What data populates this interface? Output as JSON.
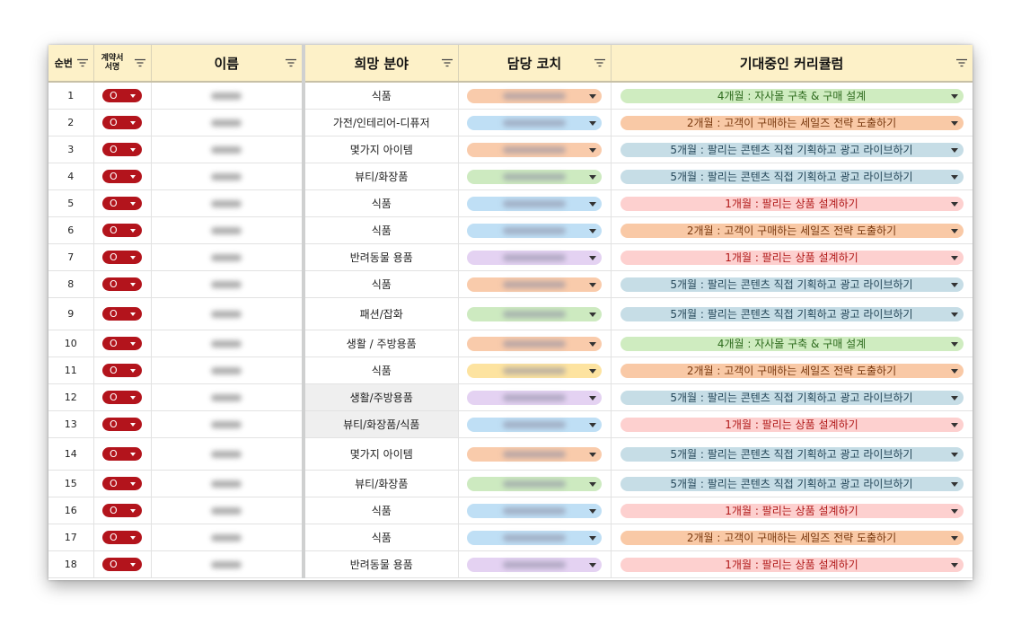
{
  "headers": {
    "seq": "순번",
    "contract": "계약서\n서명",
    "name": "이름",
    "field": "희망 분야",
    "coach": "담당 코치",
    "curriculum": "기대중인 커리큘럼"
  },
  "colors": {
    "header_bg": "#fdf1c8",
    "sign_chip": "#b3141c",
    "coach_orange": "#f9cbab",
    "coach_blue": "#bfdff5",
    "coach_green": "#cdeac0",
    "coach_purple": "#e4d2f2",
    "coach_yellow": "#fde3a0",
    "course_green": "#cfecc0",
    "course_orange": "#f9c9a6",
    "course_blue": "#c6dde6",
    "course_pink": "#fdd0cf"
  },
  "rows": [
    {
      "seq": "1",
      "sign": "O",
      "field": "식품",
      "coach": "orange",
      "curriculum": "4개월 : 자사몰 구축 & 구매 설계",
      "cc": "green"
    },
    {
      "seq": "2",
      "sign": "O",
      "field": "가전/인테리어-디퓨저",
      "coach": "blue",
      "curriculum": "2개월 : 고객이 구매하는 세일즈 전략 도출하기",
      "cc": "orange"
    },
    {
      "seq": "3",
      "sign": "O",
      "field": "몇가지 아이템",
      "coach": "orange",
      "curriculum": "5개월 : 팔리는 콘텐츠 직접 기획하고 광고 라이브하기",
      "cc": "blue"
    },
    {
      "seq": "4",
      "sign": "O",
      "field": "뷰티/화장품",
      "coach": "green",
      "curriculum": "5개월 : 팔리는 콘텐츠 직접 기획하고 광고 라이브하기",
      "cc": "blue"
    },
    {
      "seq": "5",
      "sign": "O",
      "field": "식품",
      "coach": "blue",
      "curriculum": "1개월 : 팔리는 상품 설계하기",
      "cc": "pink"
    },
    {
      "seq": "6",
      "sign": "O",
      "field": "식품",
      "coach": "blue",
      "curriculum": "2개월 : 고객이 구매하는 세일즈 전략 도출하기",
      "cc": "orange"
    },
    {
      "seq": "7",
      "sign": "O",
      "field": "반려동물 용품",
      "coach": "purple",
      "curriculum": "1개월 : 팔리는 상품 설계하기",
      "cc": "pink"
    },
    {
      "seq": "8",
      "sign": "O",
      "field": "식품",
      "coach": "orange",
      "curriculum": "5개월 : 팔리는 콘텐츠 직접 기획하고 광고 라이브하기",
      "cc": "blue"
    },
    {
      "seq": "9",
      "sign": "O",
      "field": "패션/잡화",
      "coach": "green",
      "curriculum": "5개월 : 팔리는 콘텐츠 직접 기획하고 광고 라이브하기",
      "cc": "blue",
      "tall": true
    },
    {
      "seq": "10",
      "sign": "O",
      "field": "생활 / 주방용품",
      "coach": "orange",
      "curriculum": "4개월 : 자사몰 구축 & 구매 설계",
      "cc": "green"
    },
    {
      "seq": "11",
      "sign": "O",
      "field": "식품",
      "coach": "yellow",
      "curriculum": "2개월 : 고객이 구매하는 세일즈 전략 도출하기",
      "cc": "orange"
    },
    {
      "seq": "12",
      "sign": "O",
      "field": "생활/주방용품",
      "coach": "purple",
      "curriculum": "5개월 : 팔리는 콘텐츠 직접 기획하고 광고 라이브하기",
      "cc": "blue",
      "shade": true
    },
    {
      "seq": "13",
      "sign": "O",
      "field": "뷰티/화장품/식품",
      "coach": "blue",
      "curriculum": "1개월 : 팔리는 상품 설계하기",
      "cc": "pink",
      "shade": true
    },
    {
      "seq": "14",
      "sign": "O",
      "field": "몇가지 아이템",
      "coach": "orange",
      "curriculum": "5개월 : 팔리는 콘텐츠 직접 기획하고 광고 라이브하기",
      "cc": "blue",
      "tall": true
    },
    {
      "seq": "15",
      "sign": "O",
      "field": "뷰티/화장품",
      "coach": "green",
      "curriculum": "5개월 : 팔리는 콘텐츠 직접 기획하고 광고 라이브하기",
      "cc": "blue"
    },
    {
      "seq": "16",
      "sign": "O",
      "field": "식품",
      "coach": "blue",
      "curriculum": "1개월 : 팔리는 상품 설계하기",
      "cc": "pink"
    },
    {
      "seq": "17",
      "sign": "O",
      "field": "식품",
      "coach": "blue",
      "curriculum": "2개월 : 고객이 구매하는 세일즈 전략 도출하기",
      "cc": "orange"
    },
    {
      "seq": "18",
      "sign": "O",
      "field": "반려동물 용품",
      "coach": "purple",
      "curriculum": "1개월 : 팔리는 상품 설계하기",
      "cc": "pink"
    }
  ]
}
